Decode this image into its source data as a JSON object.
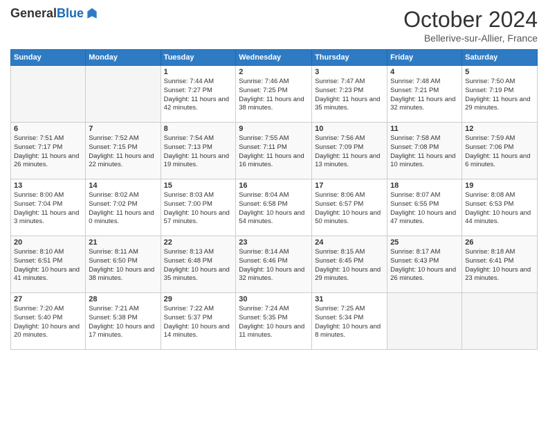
{
  "header": {
    "logo_general": "General",
    "logo_blue": "Blue",
    "month_title": "October 2024",
    "location": "Bellerive-sur-Allier, France"
  },
  "days_of_week": [
    "Sunday",
    "Monday",
    "Tuesday",
    "Wednesday",
    "Thursday",
    "Friday",
    "Saturday"
  ],
  "weeks": [
    [
      {
        "day": "",
        "empty": true
      },
      {
        "day": "",
        "empty": true
      },
      {
        "day": "1",
        "sunrise": "7:44 AM",
        "sunset": "7:27 PM",
        "daylight": "11 hours and 42 minutes."
      },
      {
        "day": "2",
        "sunrise": "7:46 AM",
        "sunset": "7:25 PM",
        "daylight": "11 hours and 38 minutes."
      },
      {
        "day": "3",
        "sunrise": "7:47 AM",
        "sunset": "7:23 PM",
        "daylight": "11 hours and 35 minutes."
      },
      {
        "day": "4",
        "sunrise": "7:48 AM",
        "sunset": "7:21 PM",
        "daylight": "11 hours and 32 minutes."
      },
      {
        "day": "5",
        "sunrise": "7:50 AM",
        "sunset": "7:19 PM",
        "daylight": "11 hours and 29 minutes."
      }
    ],
    [
      {
        "day": "6",
        "sunrise": "7:51 AM",
        "sunset": "7:17 PM",
        "daylight": "11 hours and 26 minutes."
      },
      {
        "day": "7",
        "sunrise": "7:52 AM",
        "sunset": "7:15 PM",
        "daylight": "11 hours and 22 minutes."
      },
      {
        "day": "8",
        "sunrise": "7:54 AM",
        "sunset": "7:13 PM",
        "daylight": "11 hours and 19 minutes."
      },
      {
        "day": "9",
        "sunrise": "7:55 AM",
        "sunset": "7:11 PM",
        "daylight": "11 hours and 16 minutes."
      },
      {
        "day": "10",
        "sunrise": "7:56 AM",
        "sunset": "7:09 PM",
        "daylight": "11 hours and 13 minutes."
      },
      {
        "day": "11",
        "sunrise": "7:58 AM",
        "sunset": "7:08 PM",
        "daylight": "11 hours and 10 minutes."
      },
      {
        "day": "12",
        "sunrise": "7:59 AM",
        "sunset": "7:06 PM",
        "daylight": "11 hours and 6 minutes."
      }
    ],
    [
      {
        "day": "13",
        "sunrise": "8:00 AM",
        "sunset": "7:04 PM",
        "daylight": "11 hours and 3 minutes."
      },
      {
        "day": "14",
        "sunrise": "8:02 AM",
        "sunset": "7:02 PM",
        "daylight": "11 hours and 0 minutes."
      },
      {
        "day": "15",
        "sunrise": "8:03 AM",
        "sunset": "7:00 PM",
        "daylight": "10 hours and 57 minutes."
      },
      {
        "day": "16",
        "sunrise": "8:04 AM",
        "sunset": "6:58 PM",
        "daylight": "10 hours and 54 minutes."
      },
      {
        "day": "17",
        "sunrise": "8:06 AM",
        "sunset": "6:57 PM",
        "daylight": "10 hours and 50 minutes."
      },
      {
        "day": "18",
        "sunrise": "8:07 AM",
        "sunset": "6:55 PM",
        "daylight": "10 hours and 47 minutes."
      },
      {
        "day": "19",
        "sunrise": "8:08 AM",
        "sunset": "6:53 PM",
        "daylight": "10 hours and 44 minutes."
      }
    ],
    [
      {
        "day": "20",
        "sunrise": "8:10 AM",
        "sunset": "6:51 PM",
        "daylight": "10 hours and 41 minutes."
      },
      {
        "day": "21",
        "sunrise": "8:11 AM",
        "sunset": "6:50 PM",
        "daylight": "10 hours and 38 minutes."
      },
      {
        "day": "22",
        "sunrise": "8:13 AM",
        "sunset": "6:48 PM",
        "daylight": "10 hours and 35 minutes."
      },
      {
        "day": "23",
        "sunrise": "8:14 AM",
        "sunset": "6:46 PM",
        "daylight": "10 hours and 32 minutes."
      },
      {
        "day": "24",
        "sunrise": "8:15 AM",
        "sunset": "6:45 PM",
        "daylight": "10 hours and 29 minutes."
      },
      {
        "day": "25",
        "sunrise": "8:17 AM",
        "sunset": "6:43 PM",
        "daylight": "10 hours and 26 minutes."
      },
      {
        "day": "26",
        "sunrise": "8:18 AM",
        "sunset": "6:41 PM",
        "daylight": "10 hours and 23 minutes."
      }
    ],
    [
      {
        "day": "27",
        "sunrise": "7:20 AM",
        "sunset": "5:40 PM",
        "daylight": "10 hours and 20 minutes."
      },
      {
        "day": "28",
        "sunrise": "7:21 AM",
        "sunset": "5:38 PM",
        "daylight": "10 hours and 17 minutes."
      },
      {
        "day": "29",
        "sunrise": "7:22 AM",
        "sunset": "5:37 PM",
        "daylight": "10 hours and 14 minutes."
      },
      {
        "day": "30",
        "sunrise": "7:24 AM",
        "sunset": "5:35 PM",
        "daylight": "10 hours and 11 minutes."
      },
      {
        "day": "31",
        "sunrise": "7:25 AM",
        "sunset": "5:34 PM",
        "daylight": "10 hours and 8 minutes."
      },
      {
        "day": "",
        "empty": true
      },
      {
        "day": "",
        "empty": true
      }
    ]
  ],
  "labels": {
    "sunrise": "Sunrise:",
    "sunset": "Sunset:",
    "daylight": "Daylight:"
  }
}
